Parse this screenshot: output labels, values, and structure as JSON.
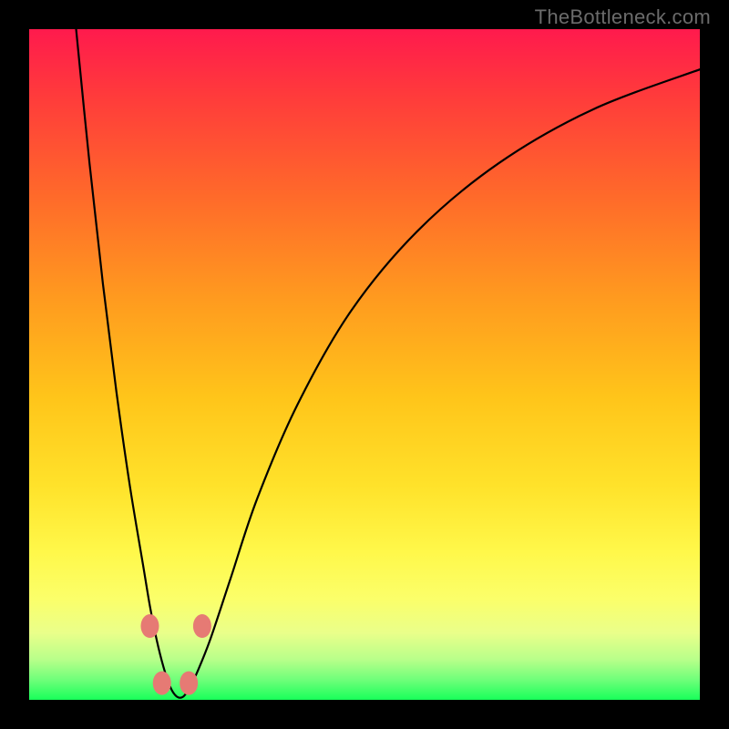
{
  "watermark": "TheBottleneck.com",
  "chart_data": {
    "type": "line",
    "title": "",
    "xlabel": "",
    "ylabel": "",
    "xlim": [
      0,
      100
    ],
    "ylim": [
      0,
      100
    ],
    "series": [
      {
        "name": "curve",
        "x": [
          7,
          9,
          11,
          13,
          15,
          17,
          18,
          19,
          20,
          21,
          22,
          23,
          24,
          25,
          27,
          30,
          34,
          40,
          48,
          58,
          70,
          84,
          100
        ],
        "values": [
          100,
          80,
          62,
          46,
          32,
          20,
          14,
          9,
          5,
          2,
          0.5,
          0.5,
          2,
          4,
          9,
          18,
          30,
          44,
          58,
          70,
          80,
          88,
          94
        ]
      }
    ],
    "markers": [
      {
        "x": 18.0,
        "y": 11.0
      },
      {
        "x": 19.8,
        "y": 2.5
      },
      {
        "x": 23.8,
        "y": 2.5
      },
      {
        "x": 25.8,
        "y": 11.0
      }
    ],
    "background_gradient": {
      "top": "#ff1a4d",
      "bottom": "#18ff5a"
    }
  }
}
